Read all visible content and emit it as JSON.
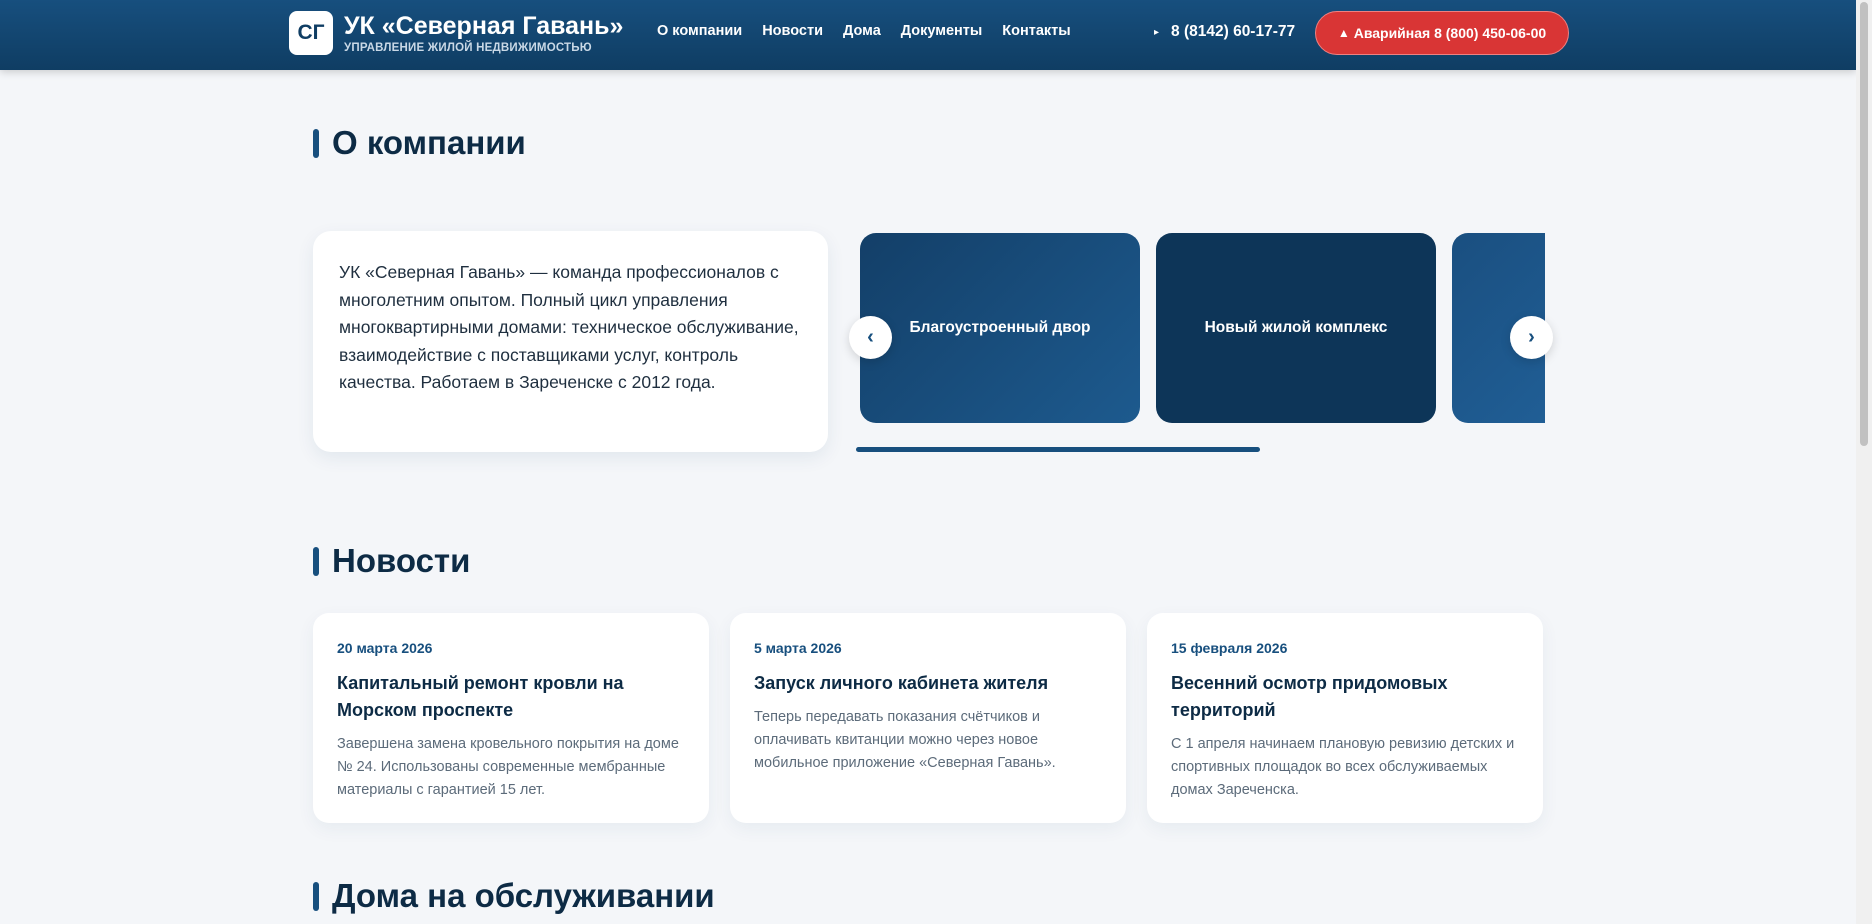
{
  "header": {
    "logo_text": "СГ",
    "brand_title": "УК «Северная Гавань»",
    "brand_subtitle": "УПРАВЛЕНИЕ ЖИЛОЙ НЕДВИЖИМОСТЬЮ",
    "nav": [
      "О компании",
      "Новости",
      "Дома",
      "Документы",
      "Контакты"
    ],
    "phone_icon": "▸",
    "phone": "8 (8142) 60-17-77",
    "emergency_icon": "▲",
    "emergency_label": "Аварийная 8 (800) 450-06-00"
  },
  "about": {
    "title": "О компании",
    "text": "УК «Северная Гавань» — команда профессионалов с многолетним опытом. Полный цикл управления многоквартирными домами: техническое обслуживание, взаимодействие с поставщиками услуг, контроль качества. Работаем в Зареченске с 2012 года.",
    "slides": [
      "Благоустроенный двор",
      "Новый жилой комплекс",
      ""
    ],
    "prev_label": "‹",
    "next_label": "›"
  },
  "news": {
    "title": "Новости",
    "items": [
      {
        "date": "20 марта 2026",
        "title": "Капитальный ремонт кровли на Морском проспекте",
        "text": "Завершена замена кровельного покрытия на доме № 24. Использованы современные мембранные материалы с гарантией 15 лет."
      },
      {
        "date": "5 марта 2026",
        "title": "Запуск личного кабинета жителя",
        "text": "Теперь передавать показания счётчиков и оплачивать квитанции можно через новое мобильное приложение «Северная Гавань»."
      },
      {
        "date": "15 февраля 2026",
        "title": "Весенний осмотр придомовых территорий",
        "text": "С 1 апреля начинаем плановую ревизию детских и спортивных площадок во всех обслуживаемых домах Зареченска."
      }
    ]
  },
  "houses": {
    "title": "Дома на обслуживании"
  },
  "colors": {
    "primary": "#174f7e",
    "primary_dark": "#0f3d63",
    "emergency": "#d93535",
    "background": "#f4f6f9"
  }
}
